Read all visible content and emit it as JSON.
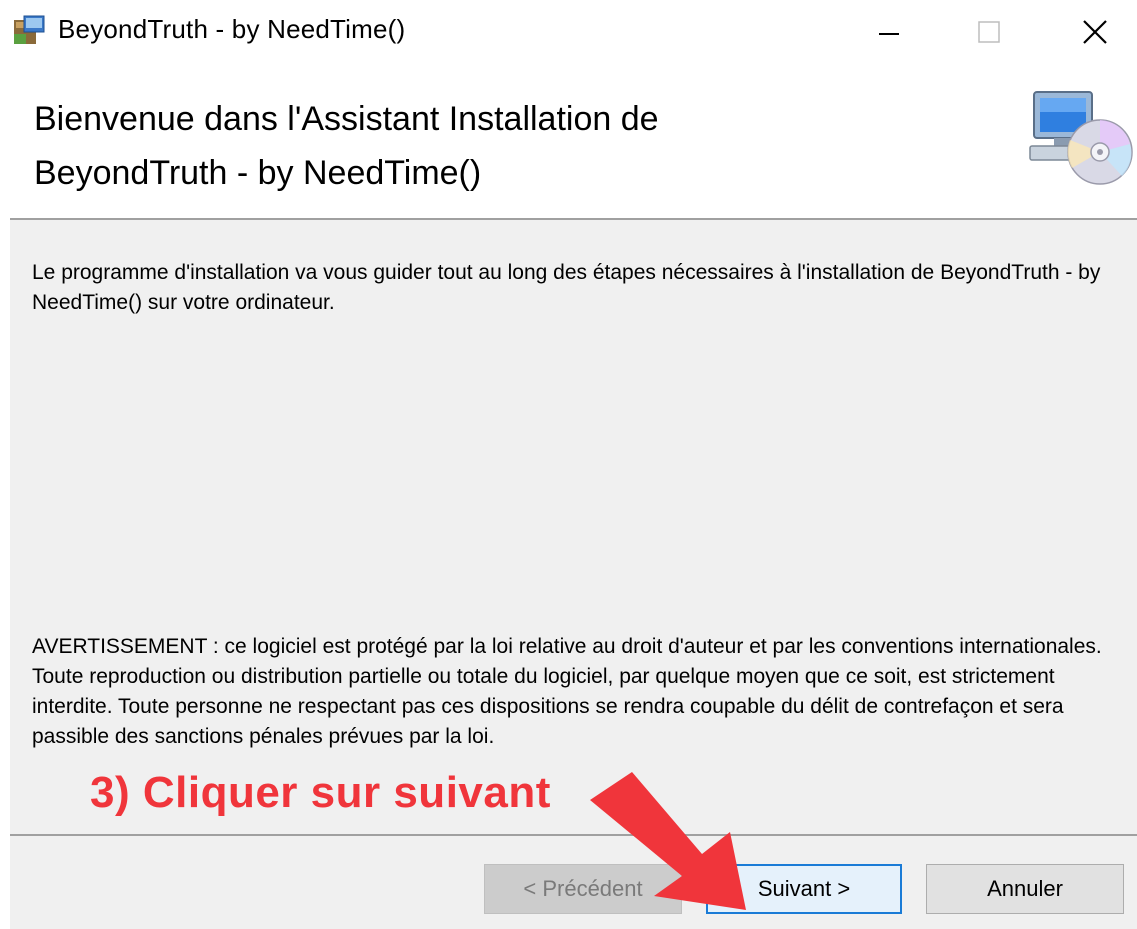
{
  "window": {
    "title": "BeyondTruth - by NeedTime()",
    "controls": {
      "minimize": "minimize-icon",
      "maximize": "maximize-icon",
      "close": "close-icon"
    }
  },
  "header": {
    "heading": "Bienvenue dans l'Assistant Installation de\nBeyondTruth - by NeedTime()",
    "icon": "computer-cd-icon"
  },
  "body": {
    "intro": "Le programme d'installation va vous guider tout au long des étapes nécessaires à l'installation de BeyondTruth - by NeedTime() sur votre ordinateur.",
    "warning": "AVERTISSEMENT : ce logiciel est protégé par la loi relative au droit d'auteur et par les conventions internationales. Toute reproduction ou distribution partielle ou totale du logiciel, par quelque moyen que ce soit, est strictement interdite. Toute personne ne respectant pas ces dispositions se rendra coupable du délit de contrefaçon et sera passible des sanctions pénales prévues par la loi."
  },
  "annotation": {
    "text": "3) Cliquer sur suivant",
    "color": "#f0353b"
  },
  "buttons": {
    "previous": "< Précédent",
    "next": "Suivant >",
    "cancel": "Annuler"
  },
  "colors": {
    "accent": "#1a7bd6",
    "panel_bg": "#f0f0f0",
    "arrow": "#f0353b"
  }
}
